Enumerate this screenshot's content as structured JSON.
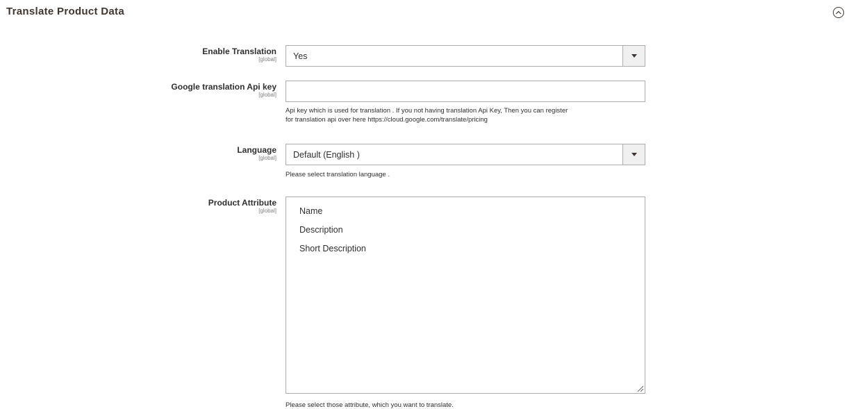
{
  "section": {
    "title": "Translate Product Data",
    "collapse_icon": "chevron-up-circle-icon"
  },
  "fields": {
    "enable_translation": {
      "label": "Enable Translation",
      "scope": "[global]",
      "value": "Yes"
    },
    "api_key": {
      "label": "Google translation Api key",
      "scope": "[global]",
      "value": "",
      "note_line1": "Api key which is used for translation . If you not having translation Api Key, Then you can register",
      "note_line2": "for translation api over here https://cloud.google.com/translate/pricing"
    },
    "language": {
      "label": "Language",
      "scope": "[global]",
      "value": "Default (English )",
      "note": "Please select translation language ."
    },
    "product_attribute": {
      "label": "Product Attribute",
      "scope": "[global]",
      "options": [
        "Name",
        "Description",
        "Short Description"
      ],
      "note": "Please select those attribute, which you want to translate."
    }
  }
}
